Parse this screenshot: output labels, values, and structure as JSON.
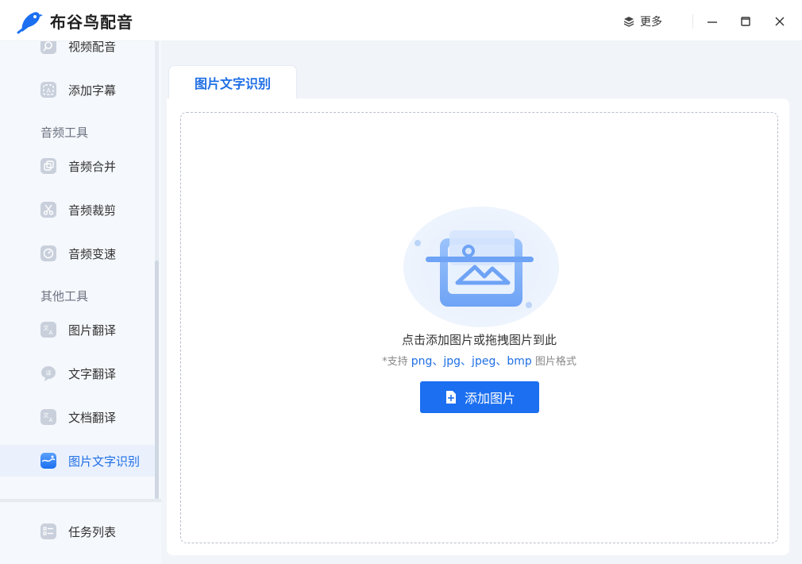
{
  "app": {
    "title": "布谷鸟配音"
  },
  "titlebar": {
    "more_label": "更多"
  },
  "sidebar": {
    "items_top": [
      {
        "label": "视频配音"
      },
      {
        "label": "添加字幕"
      }
    ],
    "section_audio": "音频工具",
    "items_audio": [
      {
        "label": "音频合并"
      },
      {
        "label": "音频裁剪"
      },
      {
        "label": "音频变速"
      }
    ],
    "section_other": "其他工具",
    "items_other": [
      {
        "label": "图片翻译"
      },
      {
        "label": "文字翻译"
      },
      {
        "label": "文档翻译"
      },
      {
        "label": "图片文字识别"
      }
    ],
    "bottom": {
      "label": "任务列表"
    }
  },
  "main": {
    "tab_label": "图片文字识别",
    "dropzone": {
      "hint": "点击添加图片或拖拽图片到此",
      "support_prefix": "*支持",
      "formats": "png、jpg、jpeg、bmp",
      "support_suffix": "图片格式",
      "button_label": "添加图片"
    }
  },
  "colors": {
    "accent": "#1b6ff0",
    "sidebar_bg": "#f5f8fc",
    "active_bg": "#eaf1fd"
  }
}
